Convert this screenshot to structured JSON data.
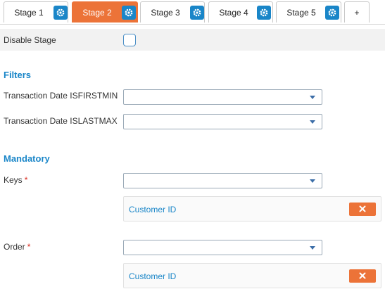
{
  "tabs": [
    {
      "label": "Stage 1",
      "active": false
    },
    {
      "label": "Stage 2",
      "active": true
    },
    {
      "label": "Stage 3",
      "active": false
    },
    {
      "label": "Stage 4",
      "active": false
    },
    {
      "label": "Stage 5",
      "active": false
    }
  ],
  "add_tab_label": "+",
  "disable_stage": {
    "label": "Disable Stage",
    "checked": false
  },
  "filters": {
    "title": "Filters",
    "fields": [
      {
        "label": "Transaction Date ISFIRSTMIN",
        "value": ""
      },
      {
        "label": "Transaction Date ISLASTMAX",
        "value": ""
      }
    ]
  },
  "mandatory": {
    "title": "Mandatory",
    "keys": {
      "label": "Keys",
      "required_mark": "*",
      "value": "",
      "chips": [
        "Customer ID"
      ]
    },
    "order": {
      "label": "Order",
      "required_mark": "*",
      "value": "",
      "chips": [
        "Customer ID"
      ]
    }
  },
  "icons": {
    "tab_settings": "gear-icon",
    "remove": "close-icon",
    "dropdown": "chevron-down-icon"
  },
  "colors": {
    "accent": "#1a86c8",
    "active_tab": "#ec7338",
    "remove_button": "#ec7338",
    "required": "#d9281c"
  }
}
